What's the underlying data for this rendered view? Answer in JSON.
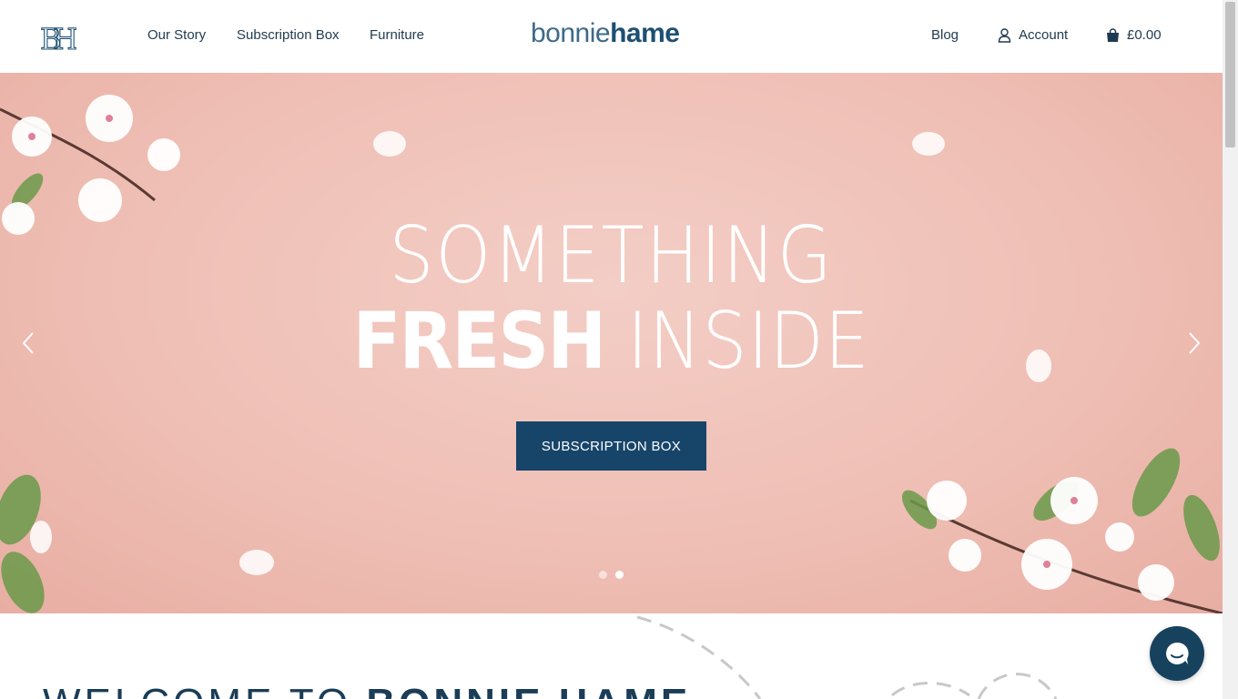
{
  "header": {
    "logo_mark": "BH",
    "nav": [
      "Our Story",
      "Subscription Box",
      "Furniture"
    ],
    "brand": {
      "light": "bonnie",
      "bold": "hame"
    },
    "blog": "Blog",
    "account": "Account",
    "cart_total": "£0.00"
  },
  "hero": {
    "line1": "SOMETHING",
    "line2_strong": "FRESH",
    "line2_thin": "INSIDE",
    "cta_label": "SUBSCRIPTION BOX",
    "slide_count": 2,
    "active_slide": 2
  },
  "welcome": {
    "light": "WELCOME TO",
    "bold": "BONNIE HAME"
  },
  "colors": {
    "accent": "#17456a",
    "hero_bg": "#efbfb5",
    "text": "#1f3a50"
  }
}
